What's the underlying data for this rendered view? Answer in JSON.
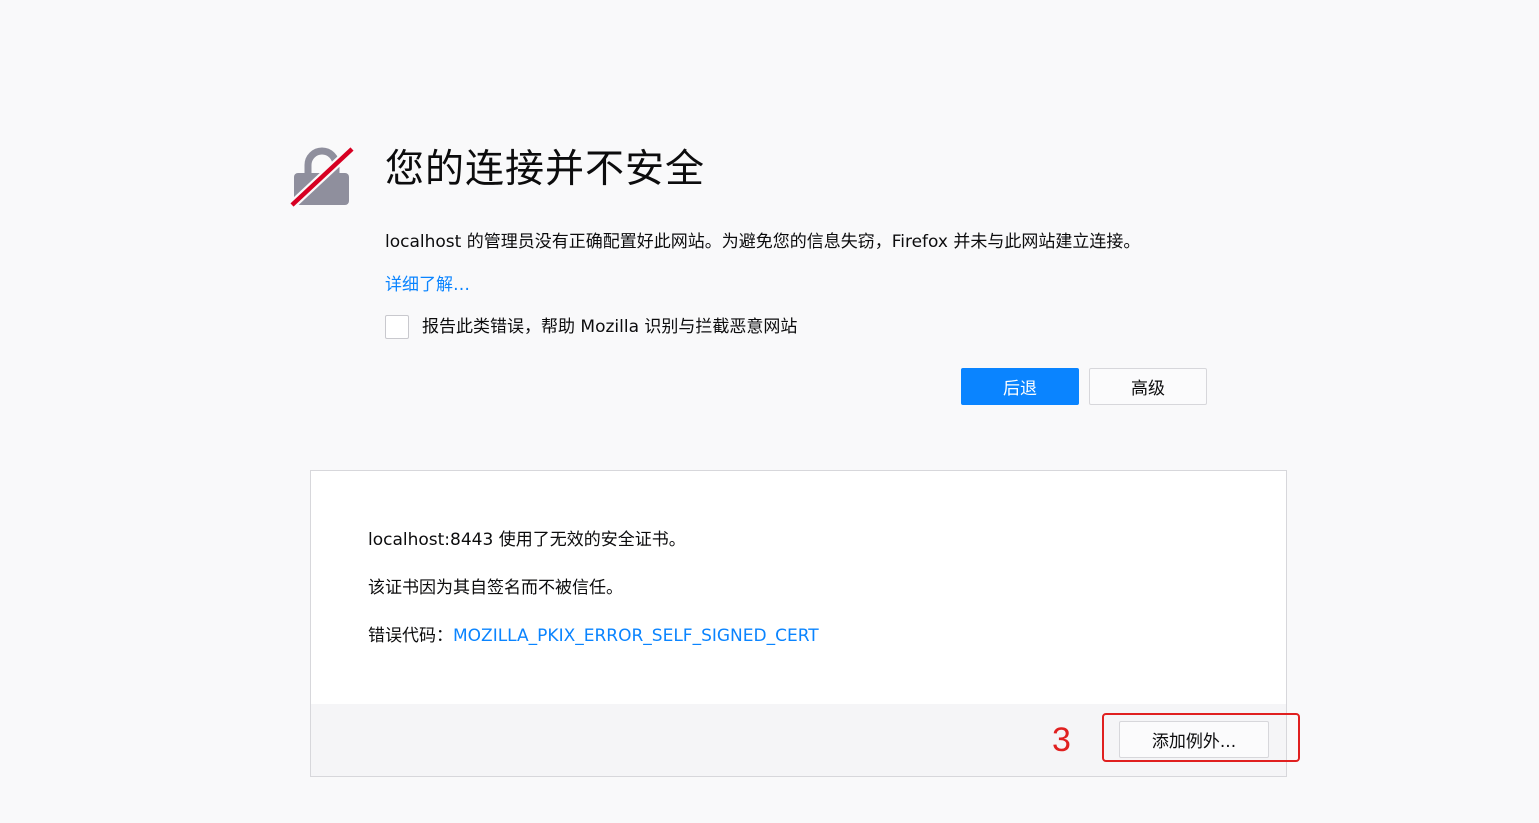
{
  "error_page": {
    "icon": "broken-lock-icon",
    "title": "您的连接并不安全",
    "description": "localhost 的管理员没有正确配置好此网站。为避免您的信息失窃，Firefox 并未与此网站建立连接。",
    "learn_more": "详细了解…",
    "report_checkbox": {
      "checked": false,
      "label": "报告此类错误，帮助 Mozilla 识别与拦截恶意网站"
    },
    "buttons": {
      "back": "后退",
      "advanced": "高级"
    }
  },
  "advanced_panel": {
    "line1": "localhost:8443 使用了无效的安全证书。",
    "line2": "该证书因为其自签名而不被信任。",
    "error_code_label": "错误代码：",
    "error_code": "MOZILLA_PKIX_ERROR_SELF_SIGNED_CERT",
    "add_exception_button": "添加例外..."
  },
  "annotation": {
    "number": "3",
    "color": "#e02020"
  },
  "colors": {
    "accent": "#0a84ff",
    "background": "#f9f9fa",
    "panel_background": "#ffffff",
    "panel_footer": "#f5f5f7",
    "lock_gray": "#8f8f9d",
    "slash_red": "#d70022"
  }
}
